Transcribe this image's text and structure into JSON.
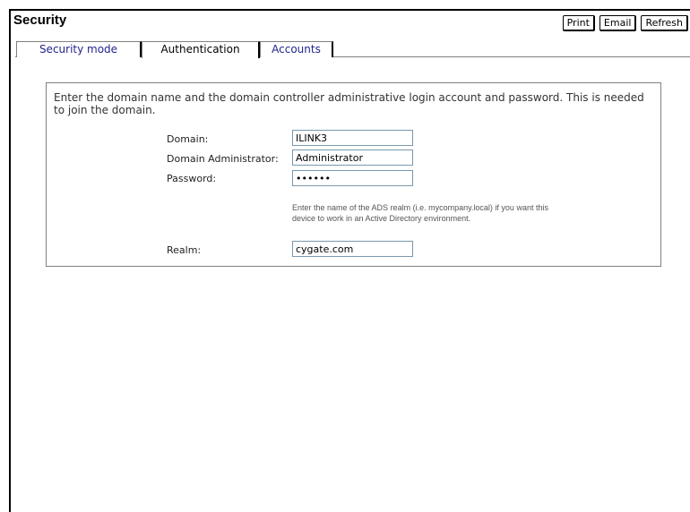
{
  "header": {
    "title": "Security"
  },
  "toolbar": {
    "print_label": "Print",
    "email_label": "Email",
    "refresh_label": "Refresh"
  },
  "tabs": [
    {
      "label": "Security mode",
      "active": false
    },
    {
      "label": "Authentication",
      "active": true
    },
    {
      "label": "Accounts",
      "active": false
    }
  ],
  "form": {
    "intro": "Enter the domain name and the domain controller administrative login account and password. This is needed to join the domain.",
    "domain": {
      "label": "Domain:",
      "value": "ILINK3"
    },
    "admin": {
      "label": "Domain Administrator:",
      "value": "Administrator"
    },
    "password": {
      "label": "Password:",
      "value": "••••••"
    },
    "realm_hint": "Enter the name of the ADS realm (i.e. mycompany.local) if you want this device to work in an Active Directory environment.",
    "realm": {
      "label": "Realm:",
      "value": "cygate.com"
    }
  },
  "colors": {
    "tab_link": "#23238e",
    "field_border": "#7a98ac"
  }
}
